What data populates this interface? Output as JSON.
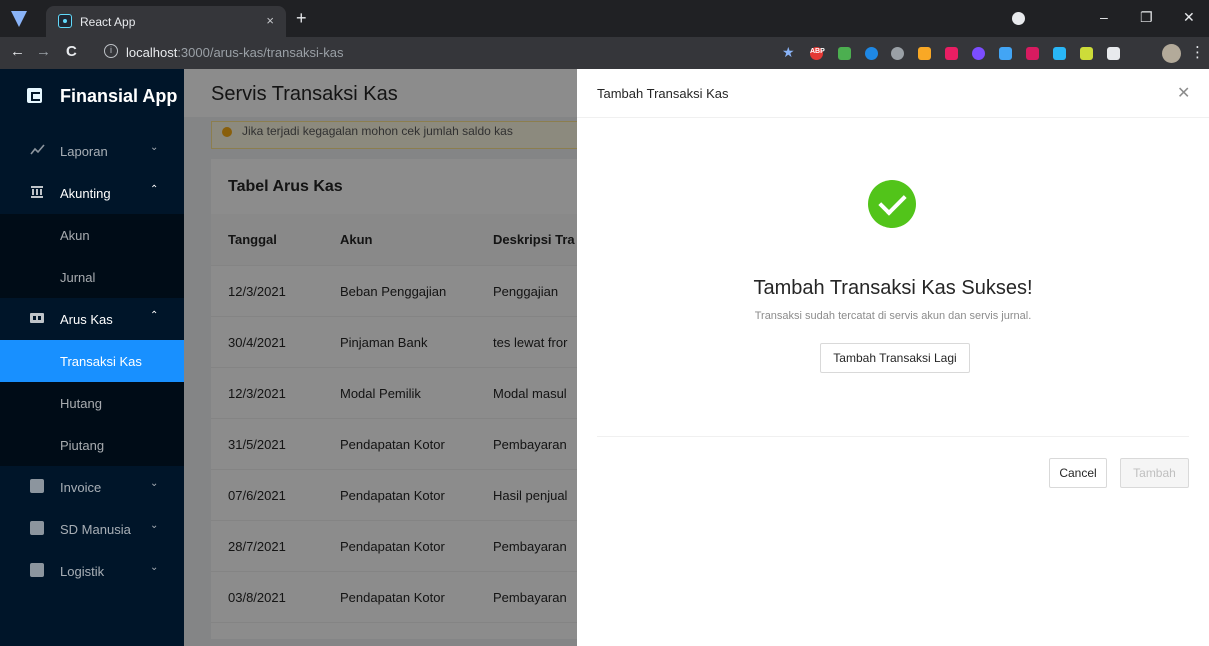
{
  "browser": {
    "tab_title": "React App",
    "tab_close": "×",
    "new_tab": "+",
    "url_host": "localhost",
    "url_path": ":3000/arus-kas/transaksi-kas",
    "info_icon_char": "i",
    "back": "←",
    "forward": "→",
    "reload": "C",
    "minimize": "–",
    "restore": "❐",
    "close": "✕",
    "bookmark_star": "★",
    "menu": "⋮",
    "extension_abp": "ABP"
  },
  "sidebar": {
    "app_name": "Finansial App",
    "items": [
      {
        "label": "Laporan",
        "icon": "chart-icon",
        "arrow": "⌄"
      },
      {
        "label": "Akunting",
        "icon": "bank-icon",
        "arrow": "⌃"
      },
      {
        "label": "Arus Kas",
        "icon": "cash-icon",
        "arrow": "⌃"
      },
      {
        "label": "Invoice",
        "icon": "invoice-icon",
        "arrow": "⌄"
      },
      {
        "label": "SD Manusia",
        "icon": "person-icon",
        "arrow": "⌄"
      },
      {
        "label": "Logistik",
        "icon": "box-icon",
        "arrow": "⌄"
      }
    ],
    "akunting_sub": [
      "Akun",
      "Jurnal"
    ],
    "aruskas_sub": [
      "Transaksi Kas",
      "Hutang",
      "Piutang"
    ]
  },
  "main": {
    "title": "Servis Transaksi Kas",
    "alert": "Jika terjadi kegagalan mohon cek jumlah saldo kas",
    "table_title": "Tabel Arus Kas",
    "columns": [
      "Tanggal",
      "Akun",
      "Deskripsi Tra"
    ],
    "rows": [
      [
        "12/3/2021",
        "Beban Penggajian",
        "Penggajian"
      ],
      [
        "30/4/2021",
        "Pinjaman Bank",
        "tes lewat fror"
      ],
      [
        "12/3/2021",
        "Modal Pemilik",
        "Modal masul"
      ],
      [
        "31/5/2021",
        "Pendapatan Kotor",
        "Pembayaran"
      ],
      [
        "07/6/2021",
        "Pendapatan Kotor",
        "Hasil penjual"
      ],
      [
        "28/7/2021",
        "Pendapatan Kotor",
        "Pembayaran"
      ],
      [
        "03/8/2021",
        "Pendapatan Kotor",
        "Pembayaran"
      ]
    ]
  },
  "drawer": {
    "title": "Tambah Transaksi Kas",
    "close": "✕",
    "result_title": "Tambah Transaksi Kas Sukses!",
    "result_sub": "Transaksi sudah tercatat di servis akun dan servis jurnal.",
    "again_button": "Tambah Transaksi Lagi",
    "cancel_button": "Cancel",
    "submit_button": "Tambah"
  },
  "colors": {
    "sidebar_bg": "#001529",
    "active_blue": "#1890ff",
    "success_green": "#52c41a",
    "warning": "#faad14"
  }
}
